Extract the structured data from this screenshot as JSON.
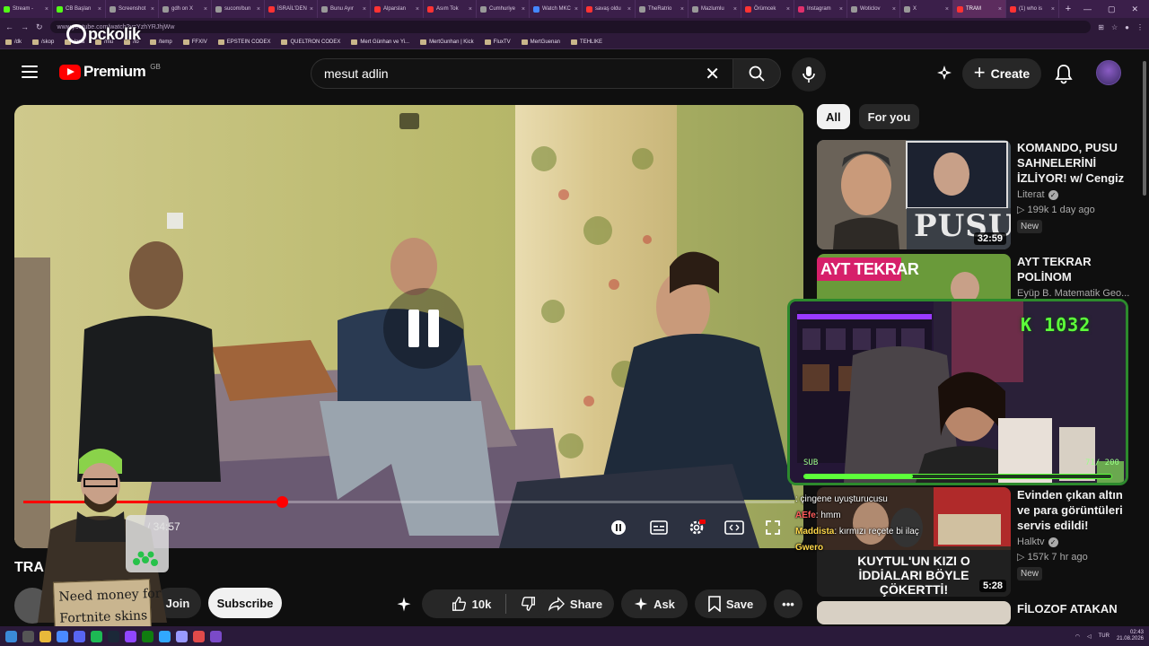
{
  "browser": {
    "tabs": [
      {
        "label": "Stream - ",
        "color": "#53fc18"
      },
      {
        "label": "CB Başlan",
        "color": "#53fc18"
      },
      {
        "label": "Screenshot",
        "color": "#999999"
      },
      {
        "label": "gdh on X",
        "color": "#999999"
      },
      {
        "label": "sucom/bun",
        "color": "#999999"
      },
      {
        "label": "İSRAİL'DEN",
        "color": "#ff3333"
      },
      {
        "label": "Bunu Ayır",
        "color": "#999999"
      },
      {
        "label": "Alparslan",
        "color": "#ff3333"
      },
      {
        "label": "Asım Tok",
        "color": "#ff3333"
      },
      {
        "label": "Cumhuriye",
        "color": "#999999"
      },
      {
        "label": "Watch MKC",
        "color": "#4488ff"
      },
      {
        "label": "savaş oldu",
        "color": "#ff3333"
      },
      {
        "label": "TheRatrio",
        "color": "#999999"
      },
      {
        "label": "Mazlumlu",
        "color": "#999999"
      },
      {
        "label": "Örümcek",
        "color": "#ff3333"
      },
      {
        "label": "Instagram",
        "color": "#e1306c"
      },
      {
        "label": "Woticlov",
        "color": "#999999"
      },
      {
        "label": "X",
        "color": "#999999"
      },
      {
        "label": "TRAM",
        "color": "#ff3333"
      },
      {
        "label": "(1) who is",
        "color": "#ff3333"
      }
    ],
    "active_tab_index": 18,
    "url": "www.youtube.com/watch?v=YzhYRJhjWw",
    "bookmarks": [
      "/dk",
      "/skop",
      "/ana",
      "/mu",
      "/to",
      "/temp",
      "FFXIV",
      "EPSTEIN CODEX",
      "QUELTRON CODEX",
      "Mert Günhan ve Yi...",
      "MertGunhan | Kick",
      "FluxTV",
      "MertGuenan",
      "TEHLIKE"
    ]
  },
  "watermark": {
    "text": "pckolik"
  },
  "youtube": {
    "logo_word": "Premium",
    "country": "GB",
    "search_value": "mesut adlin",
    "search_placeholder": "Search",
    "create_label": "Create"
  },
  "player": {
    "progress_fraction": 0.335,
    "time_total": "/ 34:57",
    "playing_state": "paused"
  },
  "video": {
    "title": "TRA",
    "join_label": "Join",
    "subscribe_label": "Subscribe",
    "likes": "10k",
    "share_label": "Share",
    "ask_label": "Ask",
    "save_label": "Save"
  },
  "sidebar": {
    "chips": [
      "All",
      "For you"
    ],
    "recommendations": [
      {
        "title": "KOMANDO, PUSU SAHNELERİNİ İZLİYOR! w/ Cengiz ...",
        "channel": "Literat",
        "verified": true,
        "stats": "▷ 199k  1 day ago",
        "badge": "New",
        "duration": "32:59",
        "thumb_text": "PUSU"
      },
      {
        "title": "AYT TEKRAR POLİNOM",
        "channel": "Eyüp B. Matematik Geo...",
        "verified": false,
        "stats": "",
        "badge": "",
        "duration": "",
        "thumb_text": "AYT TEKRAR"
      },
      {
        "title": "Evinden çıkan altın ve para görüntüleri servis edildi! Alparslan ...",
        "channel": "Halktv",
        "verified": true,
        "stats": "▷ 157k  7 hr ago",
        "badge": "New",
        "duration": "5:28",
        "thumb_text": "KUYTUL'UN KIZI O İDDİALARI BÖYLE ÇÖKERTTİ!"
      },
      {
        "title": "FİLOZOF ATAKAN",
        "channel": "",
        "verified": false,
        "stats": "",
        "badge": "",
        "duration": "",
        "thumb_text": ""
      }
    ]
  },
  "stream_overlay": {
    "kick_counter": "K 1032",
    "sub_label": "SUB",
    "sub_count": "71/ 200",
    "sub_fraction": 0.355
  },
  "chat": [
    {
      "user": "",
      "message": ": çingene uyuşturucusu",
      "color": "#ff4a4a"
    },
    {
      "user": "AEfe",
      "message": ": hmm",
      "color": "#ff5a5a"
    },
    {
      "user": "Maddista",
      "message": ": kırmızı reçete bi ilaç",
      "color": "#ffd84a"
    },
    {
      "user": "Gwero",
      "message": "",
      "color": "#ffd84a"
    }
  ],
  "sticker": {
    "sign_line1": "Need money for",
    "sign_line2": "Fortnite skins"
  },
  "taskbar": {
    "lang": "TUR",
    "time": "02:43",
    "date": "21.08.2026"
  }
}
